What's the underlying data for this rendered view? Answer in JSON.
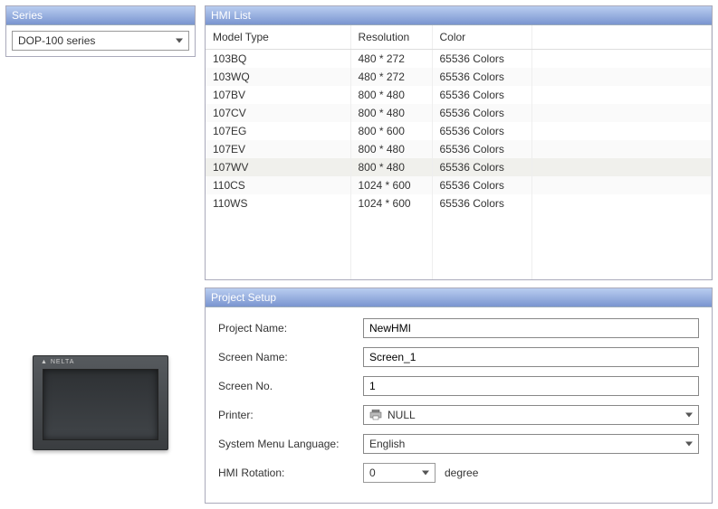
{
  "series": {
    "header": "Series",
    "selected": "DOP-100 series"
  },
  "hmi_list": {
    "header": "HMI List",
    "columns": {
      "model": "Model Type",
      "resolution": "Resolution",
      "color": "Color"
    },
    "rows": [
      {
        "model": "103BQ",
        "resolution": "480 * 272",
        "color": "65536 Colors",
        "selected": false
      },
      {
        "model": "103WQ",
        "resolution": "480 * 272",
        "color": "65536 Colors",
        "selected": false
      },
      {
        "model": "107BV",
        "resolution": "800 * 480",
        "color": "65536 Colors",
        "selected": false
      },
      {
        "model": "107CV",
        "resolution": "800 * 480",
        "color": "65536 Colors",
        "selected": false
      },
      {
        "model": "107EG",
        "resolution": "800 * 600",
        "color": "65536 Colors",
        "selected": false
      },
      {
        "model": "107EV",
        "resolution": "800 * 480",
        "color": "65536 Colors",
        "selected": false
      },
      {
        "model": "107WV",
        "resolution": "800 * 480",
        "color": "65536 Colors",
        "selected": true
      },
      {
        "model": "110CS",
        "resolution": "1024 * 600",
        "color": "65536 Colors",
        "selected": false
      },
      {
        "model": "110WS",
        "resolution": "1024 * 600",
        "color": "65536 Colors",
        "selected": false
      }
    ],
    "empty_rows": 4
  },
  "project_setup": {
    "header": "Project Setup",
    "project_name_label": "Project Name:",
    "project_name_value": "NewHMI",
    "screen_name_label": "Screen Name:",
    "screen_name_value": "Screen_1",
    "screen_no_label": "Screen No.",
    "screen_no_value": "1",
    "printer_label": "Printer:",
    "printer_value": "NULL",
    "language_label": "System Menu Language:",
    "language_value": "English",
    "rotation_label": "HMI Rotation:",
    "rotation_value": "0",
    "rotation_unit": "degree"
  },
  "device_brand": "▲ NELTA"
}
